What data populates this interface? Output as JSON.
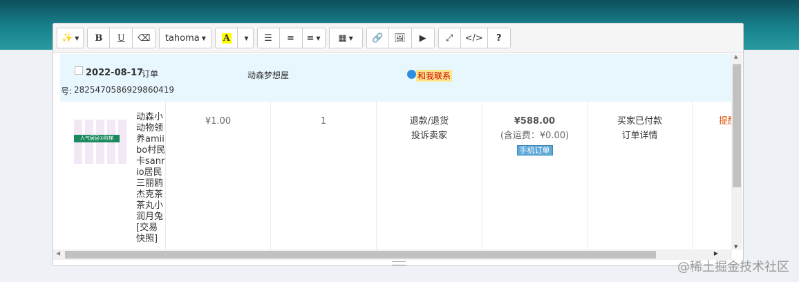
{
  "toolbar": {
    "font_name": "tahoma",
    "bold": "B",
    "underline": "U",
    "color_letter": "A",
    "code": "</>",
    "help": "?"
  },
  "order": {
    "date": "2022-08-17",
    "label": "订单",
    "number_prefix": "号:",
    "number": "2825470586929860419",
    "shop": "动森梦想屋",
    "contact": "和我联系"
  },
  "item": {
    "title": "动森小动物领养amiibo村民卡sanrio居民三丽鸥杰克茶茶丸小润月兔 [交易快照]",
    "image_banner": "人气居民①阶梯",
    "price": "¥1.00",
    "quantity": "1",
    "service_1": "退款/退货",
    "service_2": "投诉卖家",
    "total": "¥588.00",
    "shipping": "(含运费：¥0.00)",
    "mobile_badge": "手机订单",
    "status": "买家已付款",
    "detail_link": "订单详情",
    "remind": "提醒"
  },
  "watermark": "@稀土掘金技术社区",
  "colors": {
    "header_bg": "#e8f6fd",
    "remind": "#e4560f",
    "badge": "#5fa8d8"
  }
}
